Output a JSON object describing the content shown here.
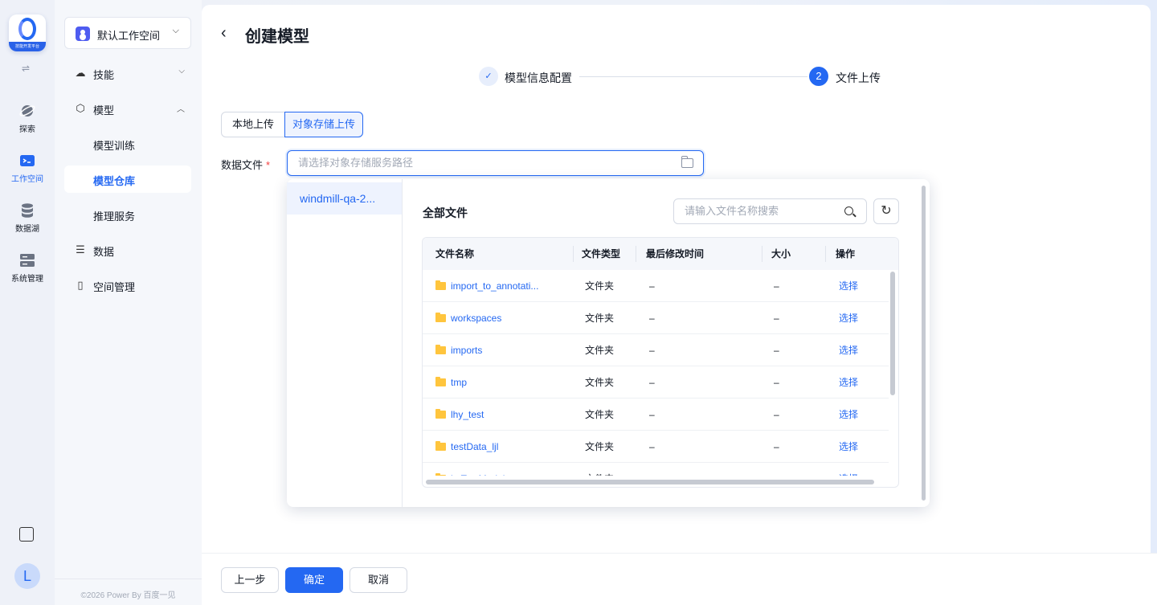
{
  "rail": {
    "logo_text": "技能开发平台",
    "items": [
      {
        "label": "探索",
        "icon": "planet-icon"
      },
      {
        "label": "工作空间",
        "icon": "terminal-icon"
      },
      {
        "label": "数据湖",
        "icon": "database-icon"
      },
      {
        "label": "系统管理",
        "icon": "server-icon"
      }
    ],
    "avatar_letter": "L"
  },
  "sidebar": {
    "workspace": "默认工作空间",
    "items": [
      {
        "label": "技能"
      },
      {
        "label": "模型"
      },
      {
        "label": "模型训练"
      },
      {
        "label": "模型仓库"
      },
      {
        "label": "推理服务"
      },
      {
        "label": "数据"
      },
      {
        "label": "空间管理"
      }
    ],
    "copyright": "©2026 Power By 百度一见"
  },
  "page": {
    "title": "创建模型",
    "steps": [
      {
        "label": "模型信息配置",
        "marker": "✓"
      },
      {
        "label": "文件上传",
        "marker": "2"
      }
    ],
    "upload_tabs": [
      "本地上传",
      "对象存储上传"
    ],
    "field_label": "数据文件",
    "required_mark": "*",
    "path_placeholder": "请选择对象存储服务路径"
  },
  "browser": {
    "bucket": "windmill-qa-2...",
    "heading": "全部文件",
    "search_placeholder": "请输入文件名称搜索",
    "columns": [
      "文件名称",
      "文件类型",
      "最后修改时间",
      "大小",
      "操作"
    ],
    "rows": [
      {
        "name": "import_to_annotati...",
        "type": "文件夹",
        "modified": "–",
        "size": "–",
        "action": "选择"
      },
      {
        "name": "workspaces",
        "type": "文件夹",
        "modified": "–",
        "size": "–",
        "action": "选择"
      },
      {
        "name": "imports",
        "type": "文件夹",
        "modified": "–",
        "size": "–",
        "action": "选择"
      },
      {
        "name": "tmp",
        "type": "文件夹",
        "modified": "–",
        "size": "–",
        "action": "选择"
      },
      {
        "name": "lhy_test",
        "type": "文件夹",
        "modified": "–",
        "size": "–",
        "action": "选择"
      },
      {
        "name": "testData_ljl",
        "type": "文件夹",
        "modified": "–",
        "size": "–",
        "action": "选择"
      },
      {
        "name": "hvTestModel",
        "type": "文件夹",
        "modified": "–",
        "size": "–",
        "action": "选择"
      }
    ]
  },
  "footer": {
    "prev": "上一步",
    "confirm": "确定",
    "cancel": "取消"
  },
  "colors": {
    "accent": "#2468f2",
    "folder": "#ffc53d",
    "required": "#f33e3e"
  }
}
